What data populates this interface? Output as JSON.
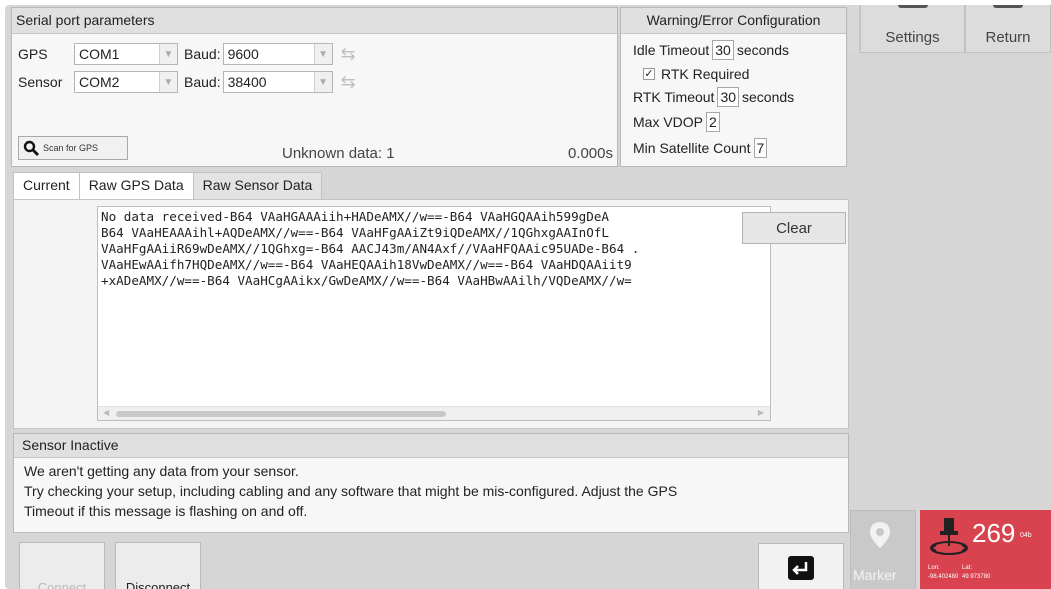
{
  "serial": {
    "title": "Serial port parameters",
    "gps": {
      "label": "GPS",
      "port": "COM1",
      "baud_label": "Baud:",
      "baud": "9600"
    },
    "sensor": {
      "label": "Sensor",
      "port": "COM2",
      "baud_label": "Baud:",
      "baud": "38400"
    },
    "scan_label": "Scan for GPS",
    "unknown_data": "Unknown data: 1",
    "elapsed": "0.000s"
  },
  "warning": {
    "title": "Warning/Error Configuration",
    "idle_timeout_label": "Idle Timeout",
    "idle_timeout_value": "30",
    "idle_timeout_unit": "seconds",
    "rtk_required_label": "RTK Required",
    "rtk_required_checked": true,
    "rtk_timeout_label": "RTK Timeout",
    "rtk_timeout_value": "30",
    "rtk_timeout_unit": "seconds",
    "max_vdop_label": "Max VDOP",
    "max_vdop_value": "2",
    "min_sat_label": "Min Satellite Count",
    "min_sat_value": "7"
  },
  "toolbar": {
    "settings_label": "Settings",
    "return_label": "Return"
  },
  "tabs": [
    {
      "label": "Current",
      "active": false
    },
    {
      "label": "Raw GPS Data",
      "active": false
    },
    {
      "label": "Raw Sensor Data",
      "active": true
    }
  ],
  "datalog": {
    "text": "No data received-B64 VAaHGAAAiih+HADeAMX//w==-B64 VAaHGQAAih599gDeA\nB64 VAaHEAAAihl+AQDeAMX//w==-B64 VAaHFgAAiZt9iQDeAMX//1QGhxgAAInOfL\nVAaHFgAAiiR69wDeAMX//1QGhxg=-B64 AACJ43m/AN4Axf//VAaHFQAAic95UADe-B64 .\nVAaHEwAAifh7HQDeAMX//w==-B64 VAaHEQAAih18VwDeAMX//w==-B64 VAaHDQAAiit9\n+xADeAMX//w==-B64 VAaHCgAAikx/GwDeAMX//w==-B64 VAaHBwAAilh/VQDeAMX//w="
  },
  "clear_label": "Clear",
  "status": {
    "title": "Sensor Inactive",
    "line1": "We aren't getting any data from your sensor.",
    "line2": "Try checking your setup, including cabling and any software that might be mis-configured. Adjust the GPS",
    "line3": "Timeout if this message is flashing on and off."
  },
  "buttons": {
    "connect": "Connect",
    "disconnect": "Disconnect"
  },
  "marker_label": "Marker",
  "gps_widget": {
    "heading": "269",
    "heading_sub": "04b",
    "lon_label": "Lon:",
    "lat_label": "Lat:",
    "lon_value": "-98.402480",
    "lat_value": "49.973780"
  },
  "colors": {
    "gps_widget_bg": "#d8434f",
    "panel_bg": "#d6d6d6"
  }
}
